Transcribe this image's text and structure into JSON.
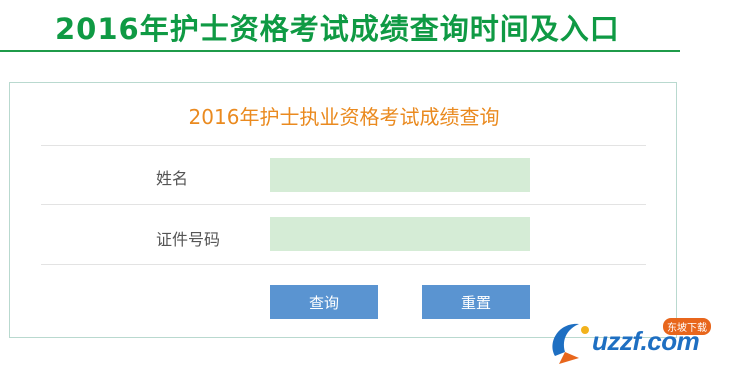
{
  "banner": {
    "title": "2016年护士资格考试成绩查询时间及入口"
  },
  "form": {
    "title": "2016年护士执业资格考试成绩查询",
    "fields": [
      {
        "label": "姓名",
        "value": "",
        "placeholder": ""
      },
      {
        "label": "证件号码",
        "value": "",
        "placeholder": ""
      }
    ],
    "buttons": {
      "search": "查询",
      "reset": "重置"
    }
  },
  "watermark": {
    "brand": "uzzf.com",
    "badge": "东坡下载"
  },
  "colors": {
    "banner_title": "#0f9a44",
    "form_title": "#ea8a1f",
    "field_bg": "#d5ecd6",
    "button_bg": "#5a94d1",
    "panel_border": "#b9d9cf"
  }
}
